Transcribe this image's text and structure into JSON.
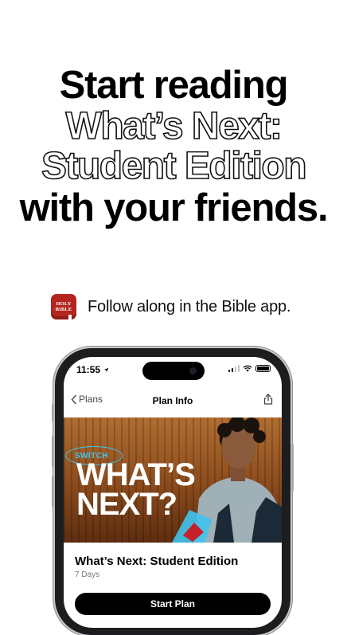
{
  "headline": {
    "line1": "Start reading",
    "line2": "What’s Next:",
    "line3": "Student Edition",
    "line4": "with your friends."
  },
  "promo": {
    "app_icon_text": [
      "HOLY",
      "BIBLE"
    ],
    "text": "Follow along in the Bible app."
  },
  "phone": {
    "status": {
      "time": "11:55",
      "location_icon": "location-arrow-icon",
      "signal_icon": "cellular-signal-icon",
      "wifi_icon": "wifi-icon",
      "battery_icon": "battery-icon"
    },
    "nav": {
      "back_label": "Plans",
      "title": "Plan Info",
      "share_icon": "share-icon"
    },
    "hero": {
      "badge": "SWITCH",
      "title_line1": "WHAT’S",
      "title_line2": "NEXT?"
    },
    "plan": {
      "title": "What’s Next: Student Edition",
      "duration": "7 Days",
      "button_label": "Start Plan"
    }
  },
  "colors": {
    "accent_blue": "#3fc4f0",
    "app_red": "#b3261e",
    "button_bg": "#000000"
  }
}
